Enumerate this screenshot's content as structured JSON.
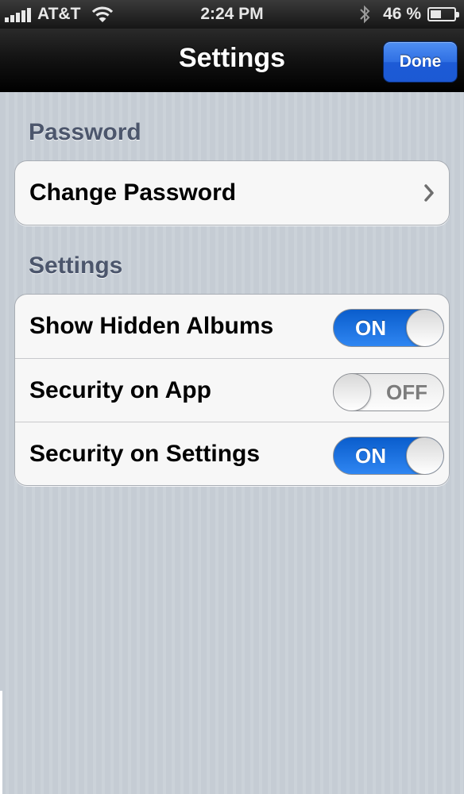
{
  "status_bar": {
    "carrier": "AT&T",
    "time": "2:24 PM",
    "battery_text": "46 %",
    "battery_level": 0.46,
    "icons": [
      "signal-icon",
      "wifi-icon",
      "bluetooth-icon",
      "battery-icon"
    ]
  },
  "nav_bar": {
    "title": "Settings",
    "done_label": "Done"
  },
  "sections": {
    "password": {
      "header": "Password",
      "rows": [
        {
          "label": "Change Password",
          "accessory": "chevron-right-icon"
        }
      ]
    },
    "settings": {
      "header": "Settings",
      "rows": [
        {
          "label": "Show Hidden Albums",
          "toggle_text": "ON",
          "state": "on"
        },
        {
          "label": "Security on App",
          "toggle_text": "OFF",
          "state": "off"
        },
        {
          "label": "Security on Settings",
          "toggle_text": "ON",
          "state": "on"
        }
      ]
    }
  },
  "colors": {
    "accent": "#2f6fe3",
    "toggle_on": "#1b74e4",
    "section_header": "#4c566c",
    "background": "#c5ccd4"
  }
}
